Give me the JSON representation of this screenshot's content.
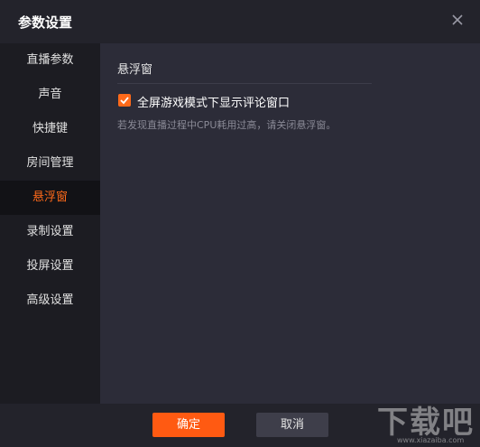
{
  "window": {
    "title": "参数设置"
  },
  "sidebar": {
    "items": [
      {
        "label": "直播参数",
        "active": false
      },
      {
        "label": "声音",
        "active": false
      },
      {
        "label": "快捷键",
        "active": false
      },
      {
        "label": "房间管理",
        "active": false
      },
      {
        "label": "悬浮窗",
        "active": true
      },
      {
        "label": "录制设置",
        "active": false
      },
      {
        "label": "投屏设置",
        "active": false
      },
      {
        "label": "高级设置",
        "active": false
      }
    ]
  },
  "content": {
    "section_title": "悬浮窗",
    "checkbox": {
      "label": "全屏游戏模式下显示评论窗口",
      "checked": true
    },
    "hint": "若发现直播过程中CPU耗用过高，请关闭悬浮窗。"
  },
  "footer": {
    "ok_label": "确定",
    "cancel_label": "取消"
  },
  "watermark": {
    "text": "下载吧",
    "sub": "www.xiazaiba.com"
  },
  "colors": {
    "accent": "#ff6a1a",
    "background": "#1f1f26",
    "panel": "#2c2c38"
  }
}
